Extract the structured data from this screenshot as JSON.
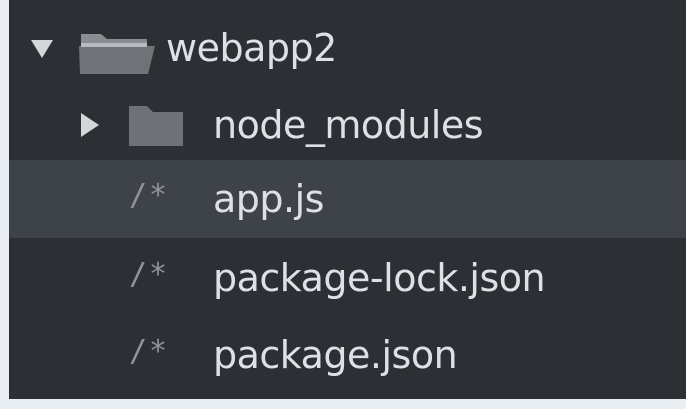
{
  "tree": {
    "root": {
      "label": "webapp2",
      "expanded": true,
      "icon": "open-folder-icon"
    },
    "items": [
      {
        "label": "node_modules",
        "type": "folder",
        "expanded": false,
        "icon": "folder-icon"
      },
      {
        "label": "app.js",
        "type": "file",
        "icon_text": "/*",
        "selected": true
      },
      {
        "label": "package-lock.json",
        "type": "file",
        "icon_text": "/*"
      },
      {
        "label": "package.json",
        "type": "file",
        "icon_text": "/*"
      }
    ]
  },
  "colors": {
    "panel_bg": "#2c2f33",
    "selected_bg": "#3e4349",
    "text": "#dde1e6",
    "icon": "#8f9399"
  }
}
